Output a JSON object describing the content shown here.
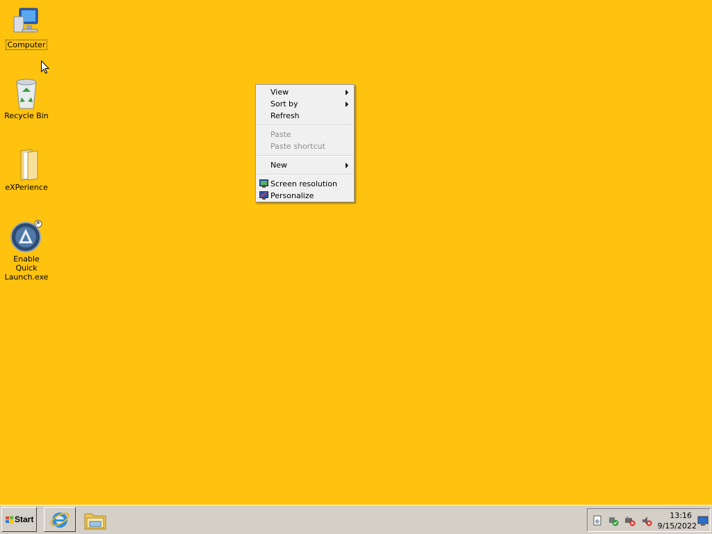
{
  "desktop": {
    "background_color": "#FFC20E",
    "icons": [
      {
        "label": "Computer",
        "icon": "computer-icon",
        "selected": true
      },
      {
        "label": "Recycle Bin",
        "icon": "recycle-bin-icon"
      },
      {
        "label": "eXPerience",
        "icon": "folder-icon"
      },
      {
        "label": "Enable Quick Launch.exe",
        "icon": "app-icon"
      }
    ]
  },
  "context_menu": {
    "items": [
      {
        "label": "View",
        "submenu": true
      },
      {
        "label": "Sort by",
        "submenu": true
      },
      {
        "label": "Refresh"
      },
      {
        "label": "Paste",
        "disabled": true
      },
      {
        "label": "Paste shortcut",
        "disabled": true
      },
      {
        "label": "New",
        "submenu": true
      },
      {
        "label": "Screen resolution",
        "icon": "screen-resolution-icon"
      },
      {
        "label": "Personalize",
        "icon": "personalize-icon"
      }
    ]
  },
  "taskbar": {
    "start_label": "Start",
    "pinned": [
      {
        "icon": "internet-explorer-icon"
      },
      {
        "icon": "windows-explorer-icon"
      }
    ],
    "tray_icons": [
      "action-center-icon",
      "network-connected-icon",
      "network-disconnected-icon",
      "volume-muted-icon"
    ],
    "clock": {
      "time": "13:16",
      "date": "9/15/2022"
    },
    "show_desktop_icon": "show-desktop-icon"
  }
}
